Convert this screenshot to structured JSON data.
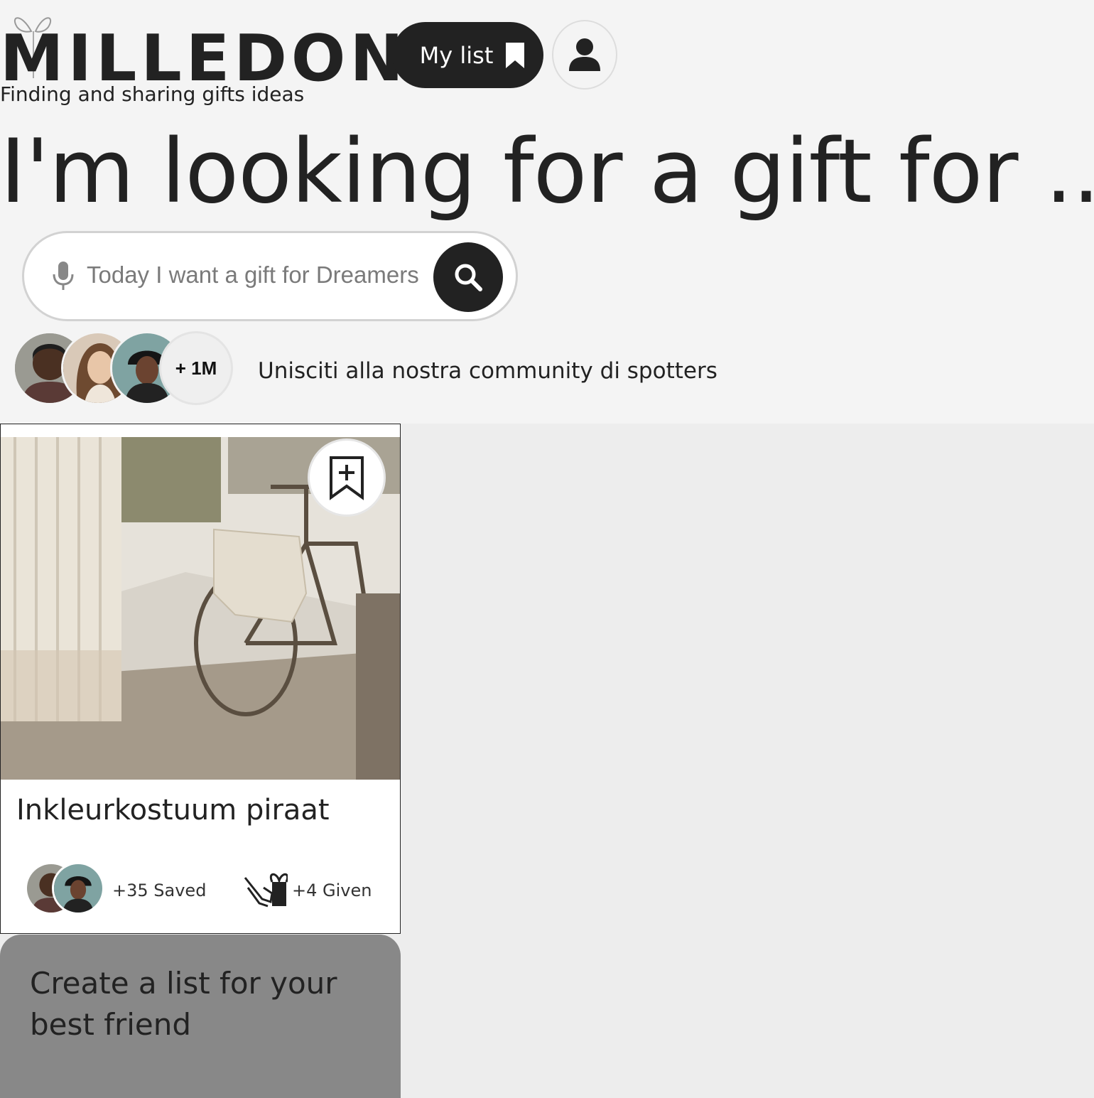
{
  "brand": {
    "logo_text": "MILLEDONI",
    "tagline": "Finding and sharing gifts ideas"
  },
  "header": {
    "mylist_label": "My list"
  },
  "hero": {
    "headline": "I'm looking for a gift for ..."
  },
  "search": {
    "placeholder": "Today I want a gift for Dreamers"
  },
  "community": {
    "more_count": "+ 1M",
    "text": "Unisciti alla nostra community di spotters"
  },
  "card": {
    "title": "Inkleurkostuum piraat",
    "saved": "+35 Saved",
    "given": "+4 Given"
  },
  "promo": {
    "text": "Create a list for your best friend"
  },
  "colors": {
    "dark": "#222222",
    "page_bg": "#ededed",
    "header_bg": "#f4f4f4",
    "promo_bg": "#888888"
  }
}
